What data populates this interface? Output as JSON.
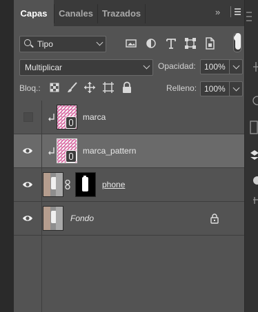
{
  "tabs": [
    {
      "label": "Capas",
      "active": true
    },
    {
      "label": "Canales",
      "active": false
    },
    {
      "label": "Trazados",
      "active": false
    }
  ],
  "tab_overflow": "»",
  "filter": {
    "kind_label": "Tipo",
    "icons": [
      "image-filter-icon",
      "adjustment-filter-icon",
      "text-filter-icon",
      "shape-filter-icon",
      "smart-object-filter-icon"
    ]
  },
  "blend": {
    "mode": "Multiplicar",
    "opacity_label": "Opacidad:",
    "opacity_value": "100%"
  },
  "lock": {
    "label": "Bloq.:",
    "icons": [
      "lock-transparent-pixels-icon",
      "lock-image-pixels-icon",
      "lock-position-icon",
      "lock-artboard-icon",
      "lock-all-icon"
    ],
    "fill_label": "Relleno:",
    "fill_value": "100%"
  },
  "layers": [
    {
      "name": "marca",
      "visible": false,
      "selected": false,
      "clipped": true,
      "smart_object": true
    },
    {
      "name": "marca_pattern",
      "visible": true,
      "selected": true,
      "clipped": true,
      "smart_object": true
    },
    {
      "name": "phone",
      "visible": true,
      "selected": false,
      "clipped": false,
      "has_mask": true
    },
    {
      "name": "Fondo",
      "visible": true,
      "selected": false,
      "clipped": false,
      "locked": true
    }
  ],
  "colors": {
    "panel_bg": "#535353",
    "selected_layer_bg": "#6a6a6a",
    "tab_bar_bg": "#3a3a3a"
  }
}
